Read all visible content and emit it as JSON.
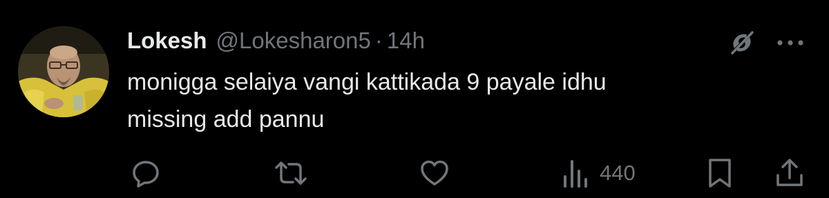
{
  "tweet": {
    "author_name": "Lokesh",
    "author_handle": "@Lokesharon5",
    "separator": "·",
    "timestamp": "14h",
    "text_line_1": "monigga selaiya vangi kattikada 9 payale idhu",
    "text_line_2": "missing add pannu"
  },
  "actions": {
    "reply_icon": "reply-icon",
    "retweet_icon": "retweet-icon",
    "like_icon": "heart-icon",
    "views_icon": "views-chart-icon",
    "views_count": "440",
    "bookmark_icon": "bookmark-icon",
    "share_icon": "share-icon"
  },
  "header_icons": {
    "grok": "grok-icon",
    "more": "more-icon"
  },
  "colors": {
    "background": "#000000",
    "primary_text": "#e7e9ea",
    "secondary_text": "#71767b"
  }
}
